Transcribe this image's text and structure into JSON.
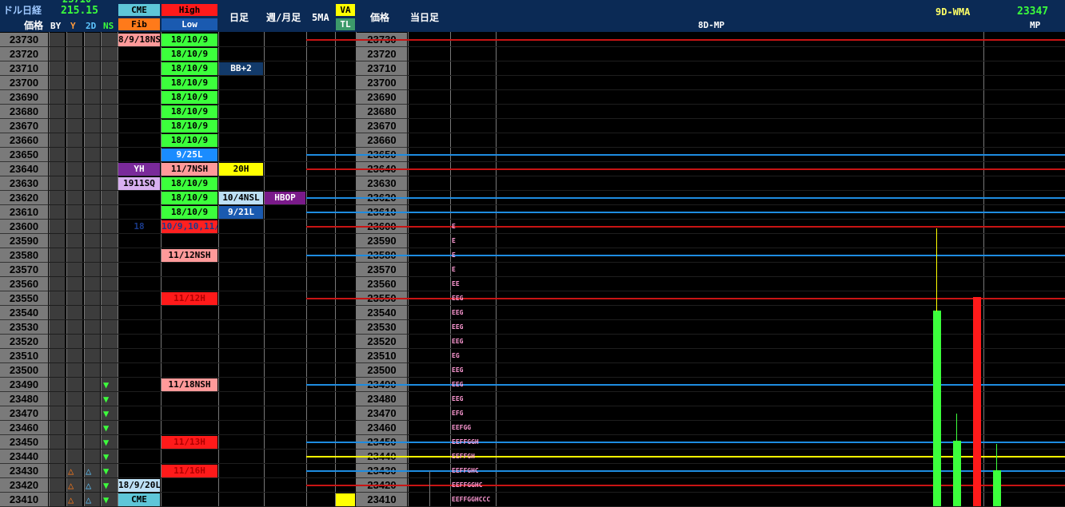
{
  "header": {
    "title": "ドル日経",
    "value": "215.15",
    "top_left_partial": "23710",
    "cme_label": "CME",
    "fib_label": "Fib",
    "high_label": "High",
    "low_label": "Low",
    "price_label": "価格",
    "cols": {
      "by": "BY",
      "y": "Y",
      "2d": "2D",
      "ns": "NS"
    },
    "daily_label": "日足",
    "weekly_label": "週/月足",
    "ma_label": "5MA",
    "va_label": "VA",
    "tl_label": "TL",
    "price_label2": "価格",
    "today_label": "当日足",
    "mp8_label": "8D-MP",
    "wma_label": "9D-WMA",
    "wma_value": "23347",
    "mp_label": "MP"
  },
  "prices": [
    "23730",
    "23720",
    "23710",
    "23700",
    "23690",
    "23680",
    "23670",
    "23660",
    "23650",
    "23640",
    "23630",
    "23620",
    "23610",
    "23600",
    "23590",
    "23580",
    "23570",
    "23560",
    "23550",
    "23540",
    "23530",
    "23520",
    "23510",
    "23500",
    "23490",
    "23480",
    "23470",
    "23460",
    "23450",
    "23440",
    "23430",
    "23420",
    "23410"
  ],
  "cme_col": [
    {
      "row": 0,
      "text": "8/9/18NS",
      "bg": "#ff9a9a",
      "fg": "#000"
    },
    {
      "row": 9,
      "text": "YH",
      "bg": "#7a2a9a",
      "fg": "#fff"
    },
    {
      "row": 10,
      "text": "1911SQ",
      "bg": "#d8b0f0",
      "fg": "#000"
    },
    {
      "row": 13,
      "text": "18",
      "bg": "#000",
      "fg": "#1a3a8a"
    },
    {
      "row": 31,
      "text": "18/9/20L",
      "bg": "#bde0f5",
      "fg": "#000"
    },
    {
      "row": 32,
      "text": "CME",
      "bg": "#5ec6d8",
      "fg": "#000"
    }
  ],
  "high_col": [
    {
      "row": 0,
      "text": "18/10/9",
      "bg": "#3cff3c",
      "fg": "#000"
    },
    {
      "row": 1,
      "text": "18/10/9",
      "bg": "#3cff3c",
      "fg": "#000"
    },
    {
      "row": 2,
      "text": "18/10/9",
      "bg": "#3cff3c",
      "fg": "#000"
    },
    {
      "row": 3,
      "text": "18/10/9",
      "bg": "#3cff3c",
      "fg": "#000"
    },
    {
      "row": 4,
      "text": "18/10/9",
      "bg": "#3cff3c",
      "fg": "#000"
    },
    {
      "row": 5,
      "text": "18/10/9",
      "bg": "#3cff3c",
      "fg": "#000"
    },
    {
      "row": 6,
      "text": "18/10/9",
      "bg": "#3cff3c",
      "fg": "#000"
    },
    {
      "row": 7,
      "text": "18/10/9",
      "bg": "#3cff3c",
      "fg": "#000"
    },
    {
      "row": 8,
      "text": "9/25L",
      "bg": "#1a8cff",
      "fg": "#fff"
    },
    {
      "row": 9,
      "text": "11/7NSH",
      "bg": "#ff9a9a",
      "fg": "#000"
    },
    {
      "row": 10,
      "text": "18/10/9",
      "bg": "#3cff3c",
      "fg": "#000"
    },
    {
      "row": 11,
      "text": "18/10/9",
      "bg": "#3cff3c",
      "fg": "#000"
    },
    {
      "row": 12,
      "text": "18/10/9",
      "bg": "#3cff3c",
      "fg": "#000"
    },
    {
      "row": 13,
      "text": "10/9,10,11/8H",
      "bg": "#ff2020",
      "fg": "#1a3a8a"
    },
    {
      "row": 15,
      "text": "11/12NSH",
      "bg": "#ff9a9a",
      "fg": "#000"
    },
    {
      "row": 18,
      "text": "11/12H",
      "bg": "#ff1a1a",
      "fg": "#b00000"
    },
    {
      "row": 24,
      "text": "11/18NSH",
      "bg": "#ff9a9a",
      "fg": "#000"
    },
    {
      "row": 28,
      "text": "11/13H",
      "bg": "#ff1a1a",
      "fg": "#b00000"
    },
    {
      "row": 30,
      "text": "11/16H",
      "bg": "#ff1a1a",
      "fg": "#b00000"
    }
  ],
  "daily_col": [
    {
      "row": 2,
      "text": "BB+2",
      "bg": "#123a6a",
      "fg": "#fff"
    },
    {
      "row": 9,
      "text": "20H",
      "bg": "#ffff00",
      "fg": "#000"
    },
    {
      "row": 11,
      "text": "10/4NSL",
      "bg": "#bde0f5",
      "fg": "#000"
    },
    {
      "row": 12,
      "text": "9/21L",
      "bg": "#1a5ab0",
      "fg": "#fff"
    }
  ],
  "weekly_col": [
    {
      "row": 11,
      "text": "HBOP",
      "bg": "#7a1a8a",
      "fg": "#fff"
    }
  ],
  "tpo": [
    {
      "row": 13,
      "text": "E"
    },
    {
      "row": 14,
      "text": "E"
    },
    {
      "row": 15,
      "text": "E"
    },
    {
      "row": 16,
      "text": "E"
    },
    {
      "row": 17,
      "text": "EE"
    },
    {
      "row": 18,
      "text": "EEG"
    },
    {
      "row": 19,
      "text": "EEG"
    },
    {
      "row": 20,
      "text": "EEG"
    },
    {
      "row": 21,
      "text": "EEG"
    },
    {
      "row": 22,
      "text": "EG"
    },
    {
      "row": 23,
      "text": "EEG"
    },
    {
      "row": 24,
      "text": "EEG"
    },
    {
      "row": 25,
      "text": "EEG"
    },
    {
      "row": 26,
      "text": "EFG"
    },
    {
      "row": 27,
      "text": "EEFGG"
    },
    {
      "row": 28,
      "text": "EEFFGGH"
    },
    {
      "row": 29,
      "text": "EEFFGH"
    },
    {
      "row": 30,
      "text": "EEFFGHC"
    },
    {
      "row": 31,
      "text": "EEFFGGHC"
    },
    {
      "row": 32,
      "text": "EEFFGGHCCC"
    }
  ],
  "hlines": [
    {
      "row": 0,
      "color": "#c81414"
    },
    {
      "row": 8,
      "color": "#1e8ce0"
    },
    {
      "row": 9,
      "color": "#c81414"
    },
    {
      "row": 11,
      "color": "#1e8ce0"
    },
    {
      "row": 12,
      "color": "#1e8ce0"
    },
    {
      "row": 13,
      "color": "#c81414"
    },
    {
      "row": 15,
      "color": "#1e8ce0"
    },
    {
      "row": 18,
      "color": "#c81414"
    },
    {
      "row": 24,
      "color": "#1e8ce0"
    },
    {
      "row": 28,
      "color": "#1e8ce0"
    },
    {
      "row": 29,
      "color": "#ffff00"
    },
    {
      "row": 30,
      "color": "#1e8ce0"
    },
    {
      "row": 31,
      "color": "#c81414"
    }
  ],
  "ns_arrows_rows": [
    24,
    25,
    26,
    27,
    28,
    29,
    30,
    31,
    32
  ],
  "by_tri_rows": [
    30,
    31,
    32
  ],
  "d2_tri_rows": [
    30,
    31,
    32
  ],
  "colors": {
    "header_bg": "#0b2a55",
    "price_grey": "#7a7a7a",
    "green": "#3cff3c",
    "red": "#ff1a1a",
    "yellow": "#ffff00"
  }
}
